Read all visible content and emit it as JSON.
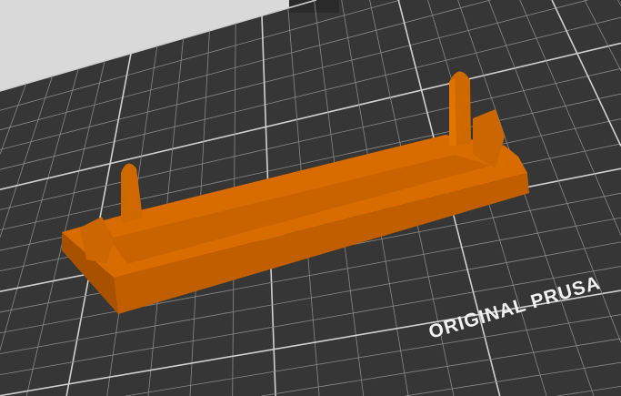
{
  "viewport": {
    "bed_label": "ORIGINAL PRUSA",
    "colors": {
      "background": "#d9d9d9",
      "bed": "#363636",
      "grid": "#8a8a8a",
      "grid_major": "#d0d0d0",
      "model_top": "#d96c00",
      "model_side": "#b85a00",
      "model_dark": "#9c4c00"
    }
  }
}
